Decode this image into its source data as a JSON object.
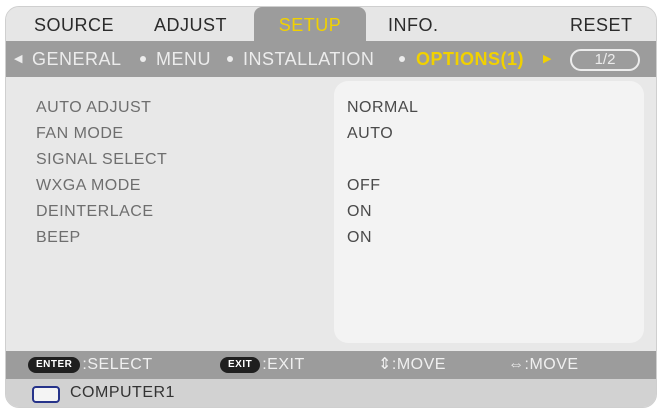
{
  "top_tabs": {
    "source": "SOURCE",
    "adjust": "ADJUST",
    "setup": "SETUP",
    "info": "INFO.",
    "reset": "RESET"
  },
  "subnav": {
    "general": "GENERAL",
    "menu": "MENU",
    "installation": "INSTALLATION",
    "options": "OPTIONS(1)",
    "page_indicator": "1/2"
  },
  "settings": {
    "labels": [
      "AUTO ADJUST",
      "FAN MODE",
      "SIGNAL SELECT",
      "WXGA MODE",
      "DEINTERLACE",
      "BEEP"
    ],
    "values": [
      "NORMAL",
      "AUTO",
      "",
      "OFF",
      "ON",
      "ON"
    ]
  },
  "hints": {
    "enter_key": "ENTER",
    "enter_action": ":SELECT",
    "exit_key": "EXIT",
    "exit_action": ":EXIT",
    "move_ud_symbol": "⇕",
    "move_ud_action": ":MOVE",
    "move_lr_symbol": "⇔",
    "move_lr_action": ":MOVE"
  },
  "source": {
    "label": "COMPUTER1"
  },
  "colors": {
    "active_accent": "#f1d100",
    "bar_gray": "#9c9c9c",
    "source_icon": "#26338a"
  }
}
